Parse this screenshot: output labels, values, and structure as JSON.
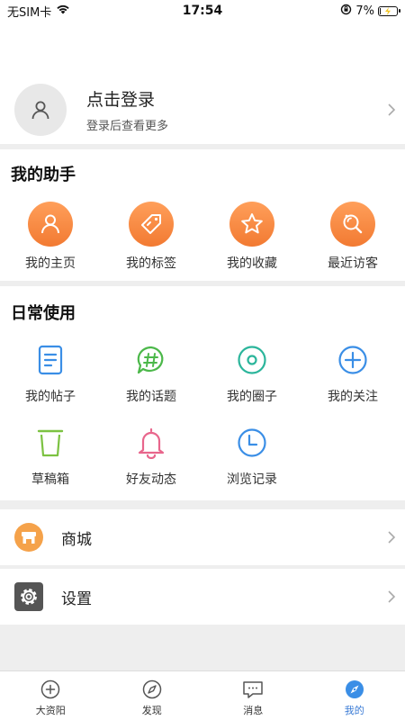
{
  "status_bar": {
    "carrier": "无SIM卡",
    "time": "17:54",
    "battery_text": "7%",
    "battery_level": 0.07
  },
  "login": {
    "title": "点击登录",
    "subtitle": "登录后查看更多"
  },
  "assistant": {
    "title": "我的助手",
    "items": [
      {
        "label": "我的主页",
        "icon": "person-icon"
      },
      {
        "label": "我的标签",
        "icon": "tag-icon"
      },
      {
        "label": "我的收藏",
        "icon": "star-icon"
      },
      {
        "label": "最近访客",
        "icon": "visitor-icon"
      }
    ]
  },
  "daily": {
    "title": "日常使用",
    "items": [
      {
        "label": "我的帖子",
        "icon": "document-icon",
        "color": "#3a8ee6"
      },
      {
        "label": "我的话题",
        "icon": "hashtag-chat-icon",
        "color": "#4cb84a"
      },
      {
        "label": "我的圈子",
        "icon": "circle-dot-icon",
        "color": "#2bb59b"
      },
      {
        "label": "我的关注",
        "icon": "plus-circle-icon",
        "color": "#3a8ee6"
      },
      {
        "label": "草稿箱",
        "icon": "trash-icon",
        "color": "#7cc242"
      },
      {
        "label": "好友动态",
        "icon": "bell-icon",
        "color": "#e8668c"
      },
      {
        "label": "浏览记录",
        "icon": "clock-icon",
        "color": "#3a8ee6"
      }
    ]
  },
  "rows": {
    "mall": {
      "label": "商城",
      "icon": "shop-icon"
    },
    "settings": {
      "label": "设置",
      "icon": "gear-icon"
    }
  },
  "tabbar": {
    "tabs": [
      {
        "label": "大资阳",
        "icon": "plus-circle-icon"
      },
      {
        "label": "发现",
        "icon": "compass-icon"
      },
      {
        "label": "消息",
        "icon": "chat-icon"
      },
      {
        "label": "我的",
        "icon": "compass-filled-icon"
      }
    ],
    "active_color": "#3a7bd5"
  }
}
